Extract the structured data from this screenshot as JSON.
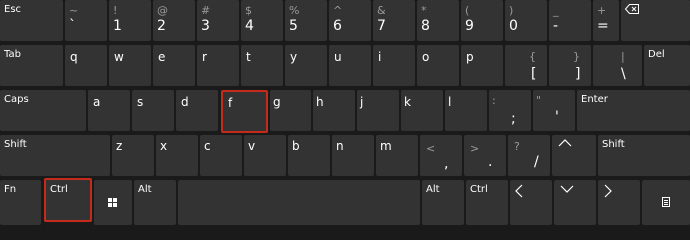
{
  "colors": {
    "background": "#1a1a1a",
    "key": "#333333",
    "highlight": "#c42b1c",
    "shift_glyph": "#9a9a9a"
  },
  "highlighted_keys": [
    "f",
    "Ctrl"
  ],
  "row1": {
    "esc": "Esc",
    "grave": {
      "shift": "~",
      "main": "`"
    },
    "d1": {
      "shift": "!",
      "main": "1"
    },
    "d2": {
      "shift": "@",
      "main": "2"
    },
    "d3": {
      "shift": "#",
      "main": "3"
    },
    "d4": {
      "shift": "$",
      "main": "4"
    },
    "d5": {
      "shift": "%",
      "main": "5"
    },
    "d6": {
      "shift": "^",
      "main": "6"
    },
    "d7": {
      "shift": "&",
      "main": "7"
    },
    "d8": {
      "shift": "*",
      "main": "8"
    },
    "d9": {
      "shift": "(",
      "main": "9"
    },
    "d0": {
      "shift": ")",
      "main": "0"
    },
    "minus": {
      "shift": "_",
      "main": "-"
    },
    "equals": {
      "shift": "+",
      "main": "="
    },
    "backspace_icon": "backspace-icon"
  },
  "row2": {
    "tab": "Tab",
    "letters": [
      "q",
      "w",
      "e",
      "r",
      "t",
      "y",
      "u",
      "i",
      "o",
      "p"
    ],
    "lbracket": {
      "shift": "{",
      "main": "["
    },
    "rbracket": {
      "shift": "}",
      "main": "]"
    },
    "backslash": {
      "shift": "|",
      "main": "\\"
    },
    "del": "Del"
  },
  "row3": {
    "caps": "Caps",
    "letters": [
      "a",
      "s",
      "d",
      "f",
      "g",
      "h",
      "j",
      "k",
      "l"
    ],
    "semicolon": {
      "shift": ":",
      "main": ";"
    },
    "quote": {
      "shift": "\"",
      "main": "'"
    },
    "enter": "Enter"
  },
  "row4": {
    "shift_left": "Shift",
    "letters": [
      "z",
      "x",
      "c",
      "v",
      "b",
      "n",
      "m"
    ],
    "comma": {
      "shift": "<",
      "main": ","
    },
    "period": {
      "shift": ">",
      "main": "."
    },
    "slash": {
      "shift": "?",
      "main": "/"
    },
    "up_icon": "arrow-up-icon",
    "shift_right": "Shift"
  },
  "row5": {
    "fn": "Fn",
    "ctrl_left": "Ctrl",
    "win_icon": "windows-logo-icon",
    "alt_left": "Alt",
    "alt_right": "Alt",
    "ctrl_right": "Ctrl",
    "left_icon": "arrow-left-icon",
    "down_icon": "arrow-down-icon",
    "right_icon": "arrow-right-icon",
    "menu_icon": "context-menu-icon"
  }
}
